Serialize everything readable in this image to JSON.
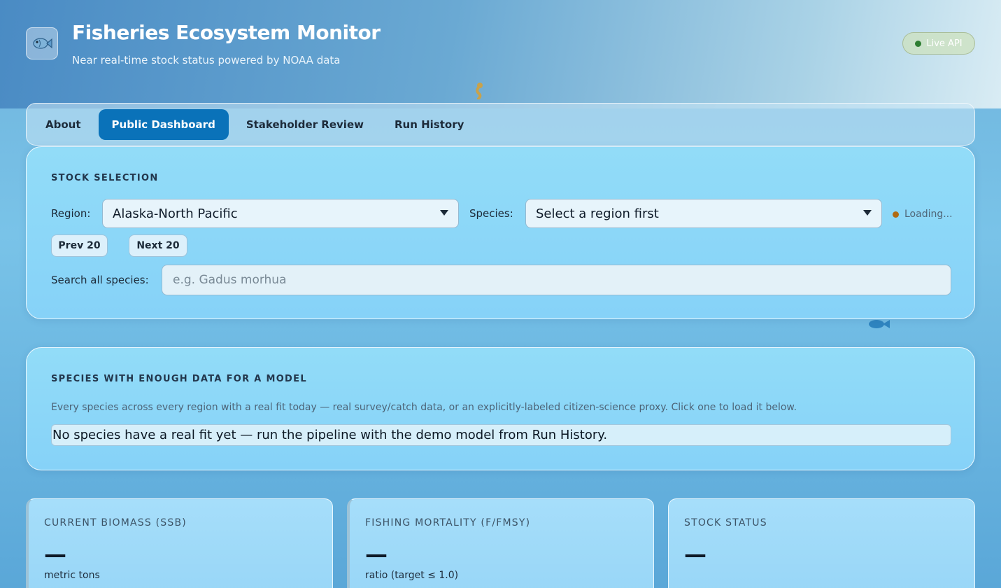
{
  "header": {
    "logo_icon": "fish-icon",
    "title": "Fisheries Ecosystem Monitor",
    "subtitle": "Near real-time stock status powered by NOAA data",
    "live_badge": "Live API"
  },
  "tabs": [
    {
      "label": "About",
      "active": false
    },
    {
      "label": "Public Dashboard",
      "active": true
    },
    {
      "label": "Stakeholder Review",
      "active": false
    },
    {
      "label": "Run History",
      "active": false
    }
  ],
  "stock_selection": {
    "heading": "STOCK SELECTION",
    "region_label": "Region:",
    "region_value": "Alaska-North Pacific",
    "species_label": "Species:",
    "species_value": "Select a region first",
    "loading_text": "Loading...",
    "prev_label": "Prev 20",
    "next_label": "Next 20",
    "search_label": "Search all species:",
    "search_placeholder": "e.g. Gadus morhua"
  },
  "model_species": {
    "heading": "SPECIES WITH ENOUGH DATA FOR A MODEL",
    "description": "Every species across every region with a real fit today — real survey/catch data, or an explicitly-labeled citizen-science proxy. Click one to load it below.",
    "empty_message": "No species have a real fit yet — run the pipeline with the demo model from Run History."
  },
  "metrics": [
    {
      "label": "CURRENT BIOMASS (SSB)",
      "value": "—",
      "unit": "metric tons"
    },
    {
      "label": "FISHING MORTALITY (F/FMSY)",
      "value": "—",
      "unit": "ratio (target ≤ 1.0)"
    },
    {
      "label": "STOCK STATUS",
      "value": "—",
      "unit": ""
    }
  ],
  "colors": {
    "active_tab": "#0a72b9",
    "live_dot": "#2e7d32",
    "loading_dot": "#b06a12"
  }
}
